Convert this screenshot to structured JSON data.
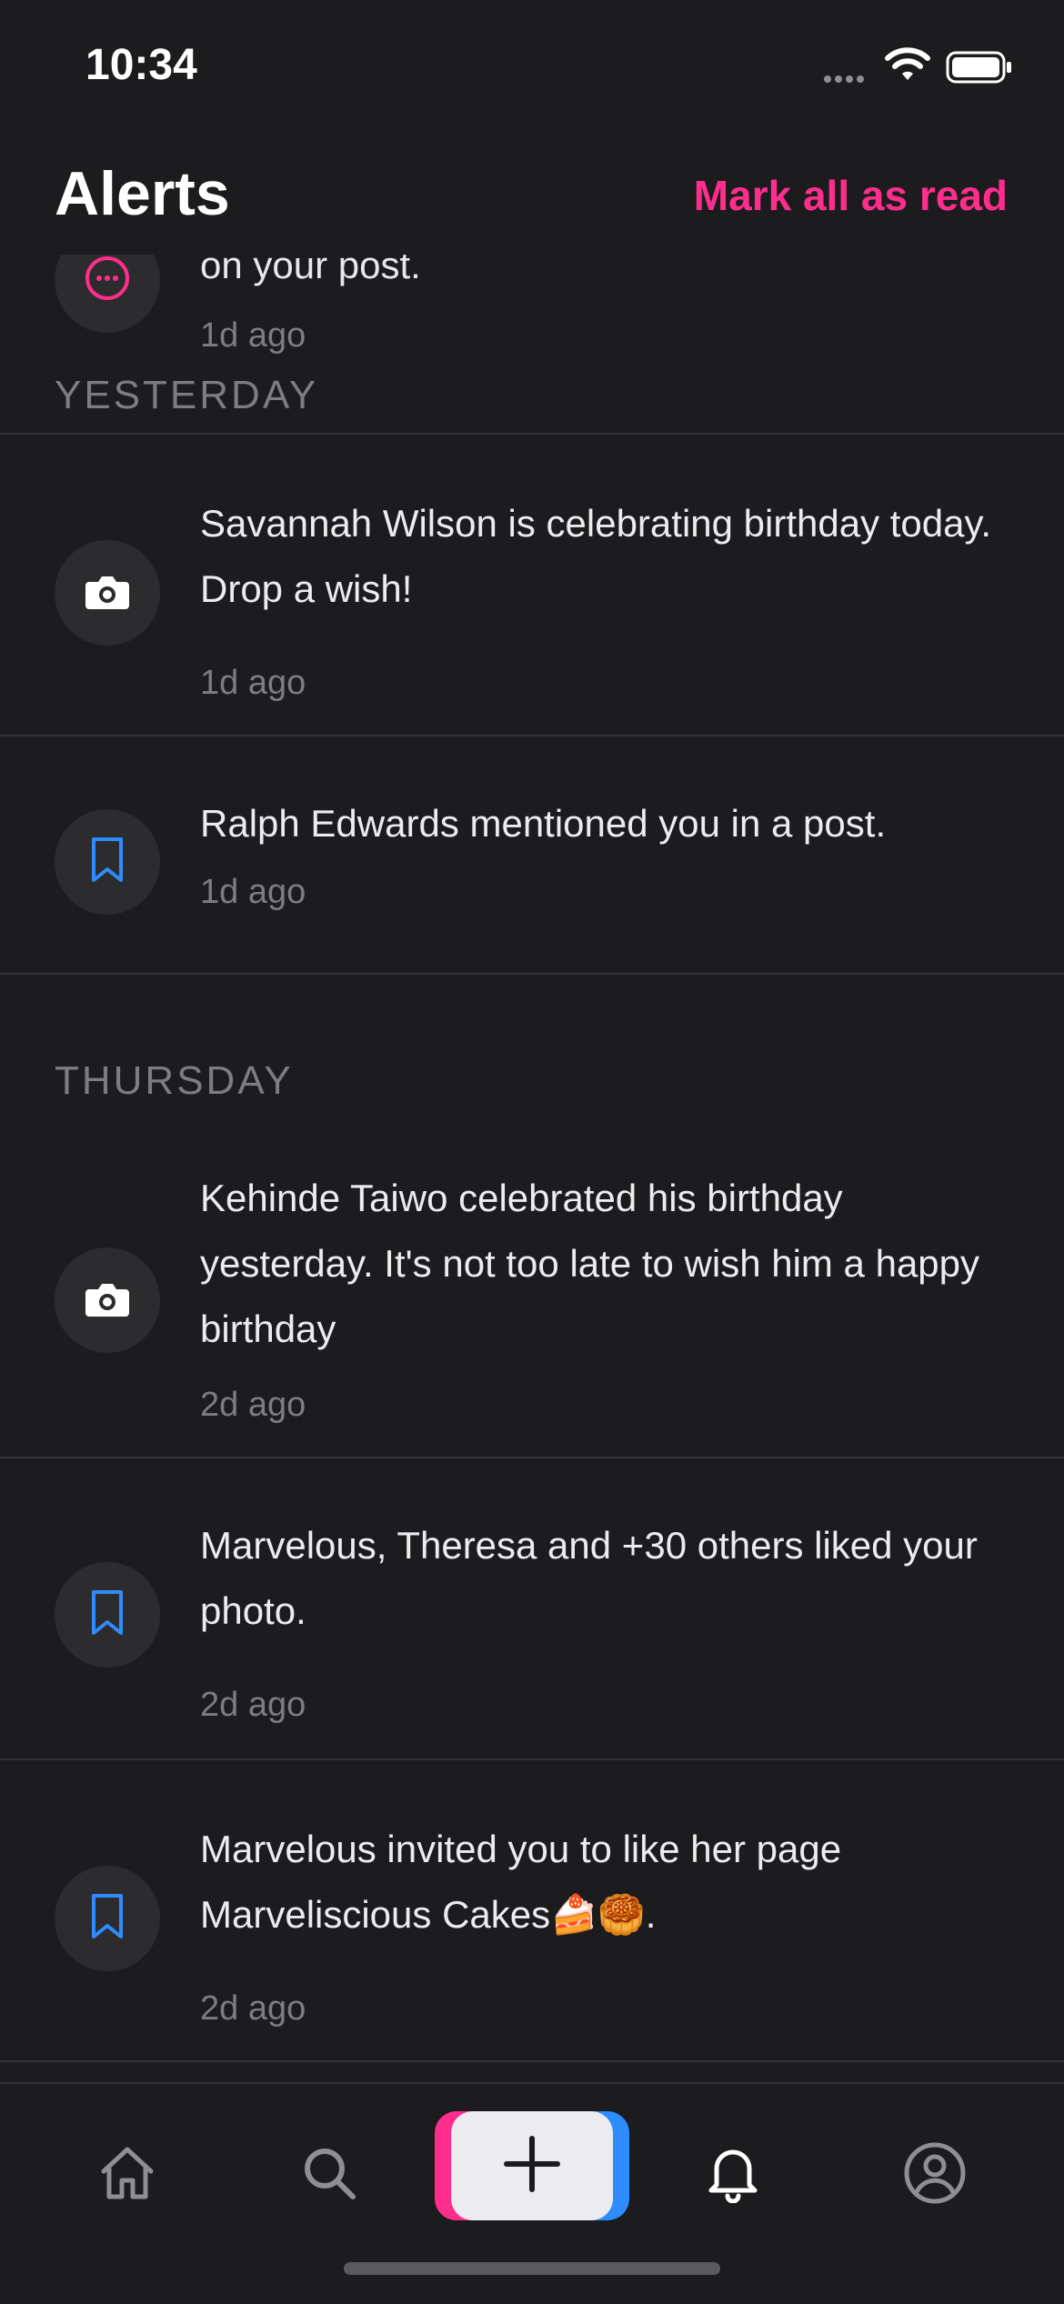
{
  "status": {
    "time": "10:34"
  },
  "header": {
    "title": "Alerts",
    "mark_all": "Mark all as read"
  },
  "partial_item": {
    "text": "on your post.",
    "ago": "1d ago",
    "icon": "chat-bubble-icon"
  },
  "sections": {
    "yesterday": "YESTERDAY",
    "thursday": "THURSDAY"
  },
  "notifications": [
    {
      "text": "Savannah Wilson is celebrating birthday today. Drop a wish!",
      "ago": "1d ago",
      "icon": "camera-icon"
    },
    {
      "text": "Ralph Edwards mentioned you in a post.",
      "ago": "1d ago",
      "icon": "bookmark-icon"
    },
    {
      "text": "Kehinde Taiwo celebrated his birthday yesterday. It's not too late to wish him a happy birthday",
      "ago": "2d ago",
      "icon": "camera-icon"
    },
    {
      "text": "Marvelous, Theresa and +30 others liked your photo.",
      "ago": "2d ago",
      "icon": "bookmark-icon"
    },
    {
      "text": "Marvelous invited you to like her page Marveliscious Cakes🍰🥮.",
      "ago": "2d ago",
      "icon": "bookmark-icon"
    }
  ],
  "tabs": [
    "home-icon",
    "search-icon",
    "add-icon",
    "bell-icon",
    "profile-icon"
  ],
  "colors": {
    "accent_pink": "#ff2e8c",
    "accent_blue": "#2e8cff",
    "background": "#1c1c1e"
  }
}
